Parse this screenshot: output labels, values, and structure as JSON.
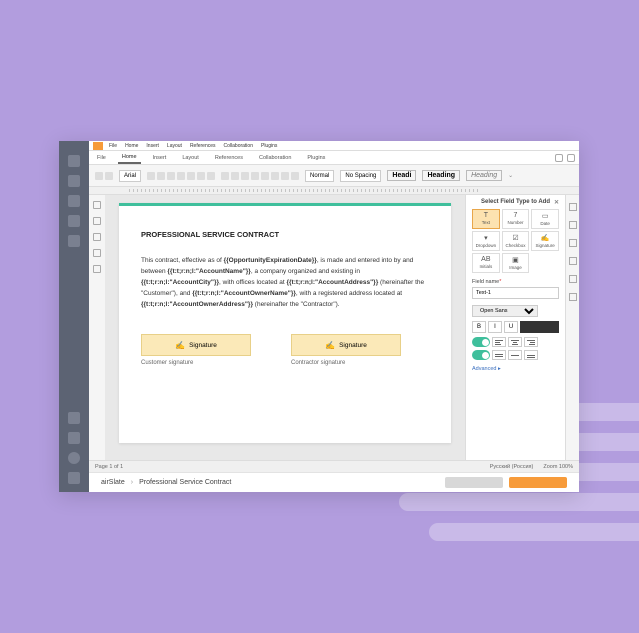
{
  "menu": {
    "items": [
      "File",
      "Home",
      "Insert",
      "Layout",
      "References",
      "Collaboration",
      "Plugins"
    ],
    "active": 1
  },
  "ribbon": {
    "font": "Arial",
    "spacing1": "Normal",
    "spacing2": "No Spacing",
    "heading1": "Headi",
    "heading2": "Heading",
    "heading3": "Heading"
  },
  "doc": {
    "title": "PROFESSIONAL SERVICE CONTRACT",
    "p1a": "This contract, effective as of ",
    "p1b": "{{OpportunityExpirationDate}}",
    "p1c": ", is made and entered into by and between ",
    "p1d": "{{t:t;r:n;l:\"AccountName\"}}",
    "p1e": ", a company organized and existing in ",
    "p1f": "{{t:t;r:n;l:\"AccountCity\"}}",
    "p1g": ", with offices located at ",
    "p1h": "{{t:t;r:n;l:\"AccountAddress\"}}",
    "p1i": " (hereinafter the \"Customer\"), and ",
    "p1j": "{{t:t;r:n;l:\"AccountOwnerName\"}}",
    "p1k": ", with a registered address located at ",
    "p1l": "{{t:t;r:n;l:\"AccountOwnerAddress\"}}",
    "p1m": " (hereinafter the \"Contractor\").",
    "sig_label": "Signature",
    "sig1": "Customer signature",
    "sig2": "Contractor signature"
  },
  "panel": {
    "title": "Select Field Type to Add",
    "types": [
      "Text",
      "Number",
      "Date",
      "Dropdown",
      "Checkbox",
      "Signature",
      "Initials",
      "Image"
    ],
    "active_type": 0,
    "field_name_label": "Field name",
    "field_name": "Text-1",
    "font": "Open Sans",
    "bold": "B",
    "italic": "I",
    "underline": "U",
    "color": "#333333",
    "advanced": "Advanced ▸"
  },
  "status": {
    "page": "Page 1 of 1",
    "lang": "Русский (Россия)",
    "zoom": "Zoom 100%"
  },
  "footer": {
    "crumb1": "airSlate",
    "crumb2": "Professional Service Contract"
  }
}
